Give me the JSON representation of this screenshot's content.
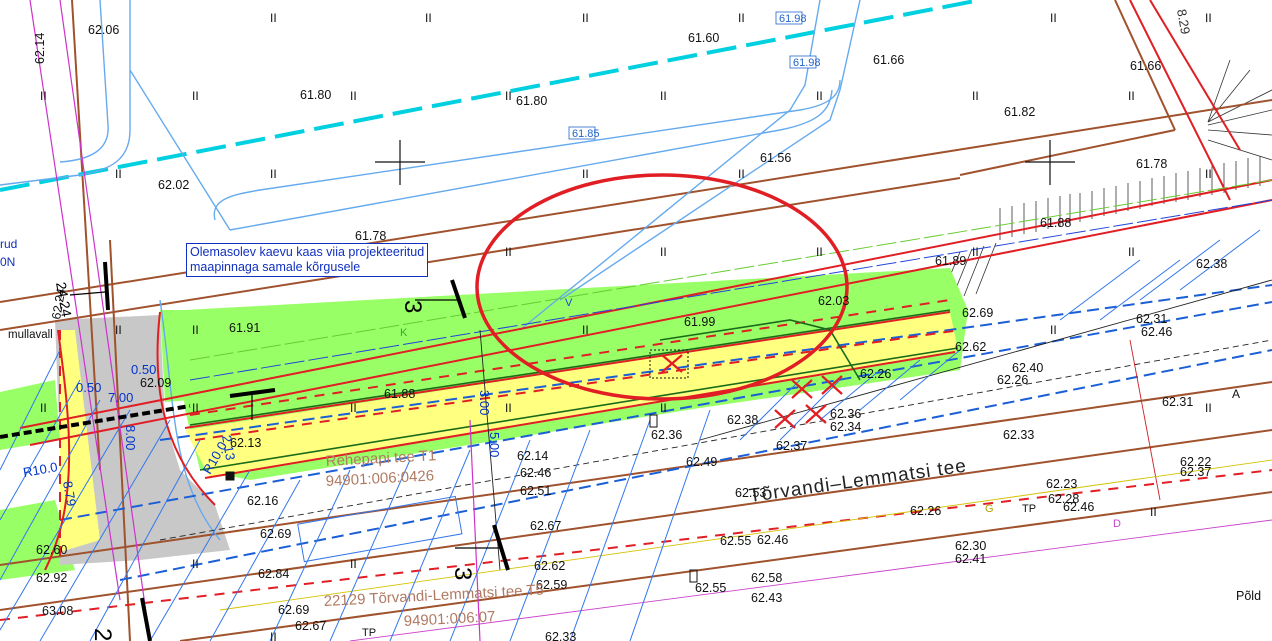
{
  "note": {
    "line1": "Olemasolev kaevu kaas viia projekteeritud",
    "line2": "maapinnaga samale kõrgusele"
  },
  "street_name": "Tõrvandi–Lemmatsi tee",
  "parcels": [
    {
      "name": "Rehepapi tee T1",
      "code": "94901:006:0426"
    },
    {
      "name": "22129 Tõrvandi-Lemmatsi tee T5",
      "code": "94901:006:07"
    },
    {
      "name": "Põld"
    }
  ],
  "section_marks": [
    "3",
    "3",
    "2"
  ],
  "spot_elevations": [
    "62.06",
    "61.60",
    "61.66",
    "61.66",
    "62.14",
    "61.80",
    "61.80",
    "61.82",
    "62.02",
    "61.56",
    "61.78",
    "61.78",
    "61.88",
    "61.89",
    "62.38",
    "61.91",
    "61.99",
    "62.03",
    "62.69",
    "62.09",
    "61.88",
    "62.13",
    "62.62",
    "62.31",
    "62.46",
    "62.40",
    "62.26",
    "62.26",
    "62.31",
    "62.38",
    "62.36",
    "62.36",
    "62.34",
    "62.33",
    "62.14",
    "62.46",
    "62.49",
    "62.51",
    "62.37",
    "62.53",
    "62.23",
    "62.28",
    "62.22",
    "62.37",
    "62.16",
    "62.69",
    "62.26",
    "62.46",
    "62.67",
    "62.55",
    "62.46",
    "62.30",
    "62.41",
    "62.60",
    "62.92",
    "62.84",
    "62.62",
    "62.59",
    "62.55",
    "62.58",
    "62.43",
    "63.08",
    "62.69",
    "62.67",
    "62.33",
    "62.24"
  ],
  "dimensions": [
    "0.50",
    "0.50",
    "7.00",
    "8.00",
    "3.00",
    "5.00",
    "2.13",
    "R10.0",
    "R10.0",
    "24.24",
    "8.79",
    "8.29"
  ],
  "utility_labels": [
    "61.98",
    "61.98",
    "61.85",
    "K",
    "V",
    "D",
    "G",
    "TP",
    "TP"
  ],
  "margin_labels": [
    "rud",
    "0N",
    "mullavall",
    "A"
  ],
  "colors": {
    "road_fill": "#ffff80",
    "verge_fill": "#99ff66",
    "paving_fill": "#c8c8c8",
    "highlight_circle": "#e01e24",
    "boundary": "#a0522d",
    "water_pipe": "#1b5fd6",
    "storm_pipe": "#00d0e0"
  },
  "icons": [
    "survey-cross-icon",
    "manhole-icon",
    "tick-mark-icon",
    "removal-x-icon"
  ]
}
